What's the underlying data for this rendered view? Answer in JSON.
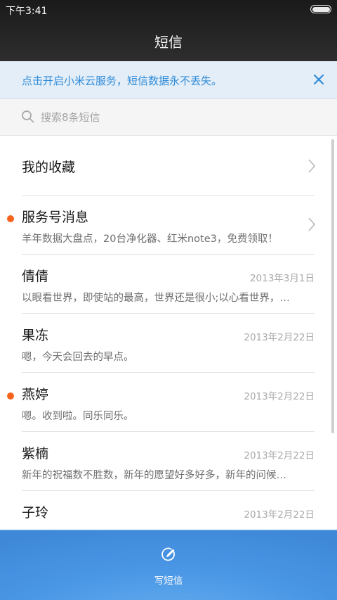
{
  "status_bar": {
    "time": "下午3:41"
  },
  "header": {
    "title": "短信"
  },
  "banner": {
    "text": "点击开启小米云服务，短信数据永不丢失。"
  },
  "search": {
    "placeholder": "搜索8条短信"
  },
  "conversations": [
    {
      "name": "我的收藏",
      "preview": "",
      "date": "",
      "unread": false,
      "has_chevron": true
    },
    {
      "name": "服务号消息",
      "preview": "羊年数据大盘点，20台净化器、红米note3，免费领取！",
      "date": "",
      "unread": true,
      "has_chevron": true
    },
    {
      "name": "倩倩",
      "preview": "以眼看世界，即使站的最高，世界还是很小;以心看世界，…",
      "date": "2013年3月1日",
      "unread": false,
      "has_chevron": false
    },
    {
      "name": "果冻",
      "preview": "嗯，今天会回去的早点。",
      "date": "2013年2月22日",
      "unread": false,
      "has_chevron": false
    },
    {
      "name": "燕婷",
      "preview": "嗯。收到啦。同乐同乐。",
      "date": "2013年2月22日",
      "unread": true,
      "has_chevron": false
    },
    {
      "name": "紫楠",
      "preview": "新年的祝福数不胜数，新年的愿望好多好多，新年的问候…",
      "date": "2013年2月22日",
      "unread": false,
      "has_chevron": false
    },
    {
      "name": "子玲",
      "preview": "",
      "date": "2013年2月22日",
      "unread": false,
      "has_chevron": false
    }
  ],
  "compose": {
    "label": "写短信",
    "icon": "compose-icon"
  },
  "colors": {
    "accent": "#2f8bd8",
    "unread_dot": "#f5631d",
    "compose_bar": "#4a97e6"
  }
}
